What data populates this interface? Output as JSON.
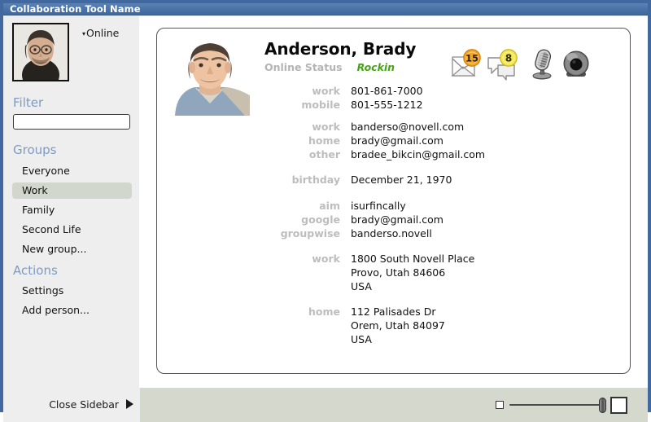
{
  "window": {
    "title": "Collaboration Tool Name"
  },
  "sidebar": {
    "avatar_alt": "user-avatar",
    "status_dropdown": {
      "caret": "▾",
      "label": "Online"
    },
    "filter": {
      "heading": "Filter",
      "value": "",
      "placeholder": ""
    },
    "groups": {
      "heading": "Groups",
      "items": [
        {
          "label": "Everyone",
          "selected": false
        },
        {
          "label": "Work",
          "selected": true
        },
        {
          "label": "Family",
          "selected": false
        },
        {
          "label": "Second Life",
          "selected": false
        },
        {
          "label": "New group...",
          "selected": false
        }
      ]
    },
    "actions": {
      "heading": "Actions",
      "items": [
        {
          "label": "Settings"
        },
        {
          "label": "Add person..."
        }
      ]
    },
    "close_sidebar": {
      "label": "Close Sidebar",
      "arrow_icon": "triangle-right-icon"
    }
  },
  "contact": {
    "name": "Anderson, Brady",
    "status_label": "Online Status",
    "status_value": "Rockin",
    "status_color": "#44a316",
    "photo_alt": "contact-photo",
    "icons": [
      {
        "name": "mail-icon",
        "badge": "15",
        "badge_color": "#f0a028"
      },
      {
        "name": "chat-icon",
        "badge": "8",
        "badge_color": "#f2e23a"
      },
      {
        "name": "microphone-icon",
        "badge": "",
        "badge_color": ""
      },
      {
        "name": "webcam-icon",
        "badge": "",
        "badge_color": ""
      }
    ],
    "groups": [
      {
        "rows": [
          {
            "label": "work",
            "value": "801-861-7000"
          },
          {
            "label": "mobile",
            "value": "801-555-1212"
          }
        ]
      },
      {
        "rows": [
          {
            "label": "work",
            "value": "banderso@novell.com"
          },
          {
            "label": "home",
            "value": "brady@gmail.com"
          },
          {
            "label": "other",
            "value": "bradee_bikcin@gmail.com"
          }
        ]
      },
      {
        "rows": [
          {
            "label": "birthday",
            "value": "December 21, 1970"
          }
        ]
      },
      {
        "rows": [
          {
            "label": "aim",
            "value": "isurfincally"
          },
          {
            "label": "google",
            "value": "brady@gmail.com"
          },
          {
            "label": "groupwise",
            "value": "banderso.novell"
          }
        ]
      },
      {
        "rows": [
          {
            "label": "work",
            "value": "1800 South Novell Place"
          },
          {
            "label": "",
            "value": "Provo, Utah 84606"
          },
          {
            "label": "",
            "value": "USA"
          }
        ]
      },
      {
        "rows": [
          {
            "label": "home",
            "value": "112 Palisades Dr"
          },
          {
            "label": "",
            "value": "Orem, Utah 84097"
          },
          {
            "label": "",
            "value": "USA"
          }
        ]
      }
    ]
  },
  "bottom": {
    "zoom_slider": {
      "small_icon": "small-square-icon",
      "large_icon": "large-square-icon",
      "thumb": "slider-thumb",
      "value_percent": 78
    }
  },
  "colors": {
    "titlebar": "#41699f",
    "sidebar_bg": "#eeeeee",
    "heading": "#7d9bc4",
    "selection": "#d2d7cd",
    "bottom_bar": "#d4d8cd"
  }
}
